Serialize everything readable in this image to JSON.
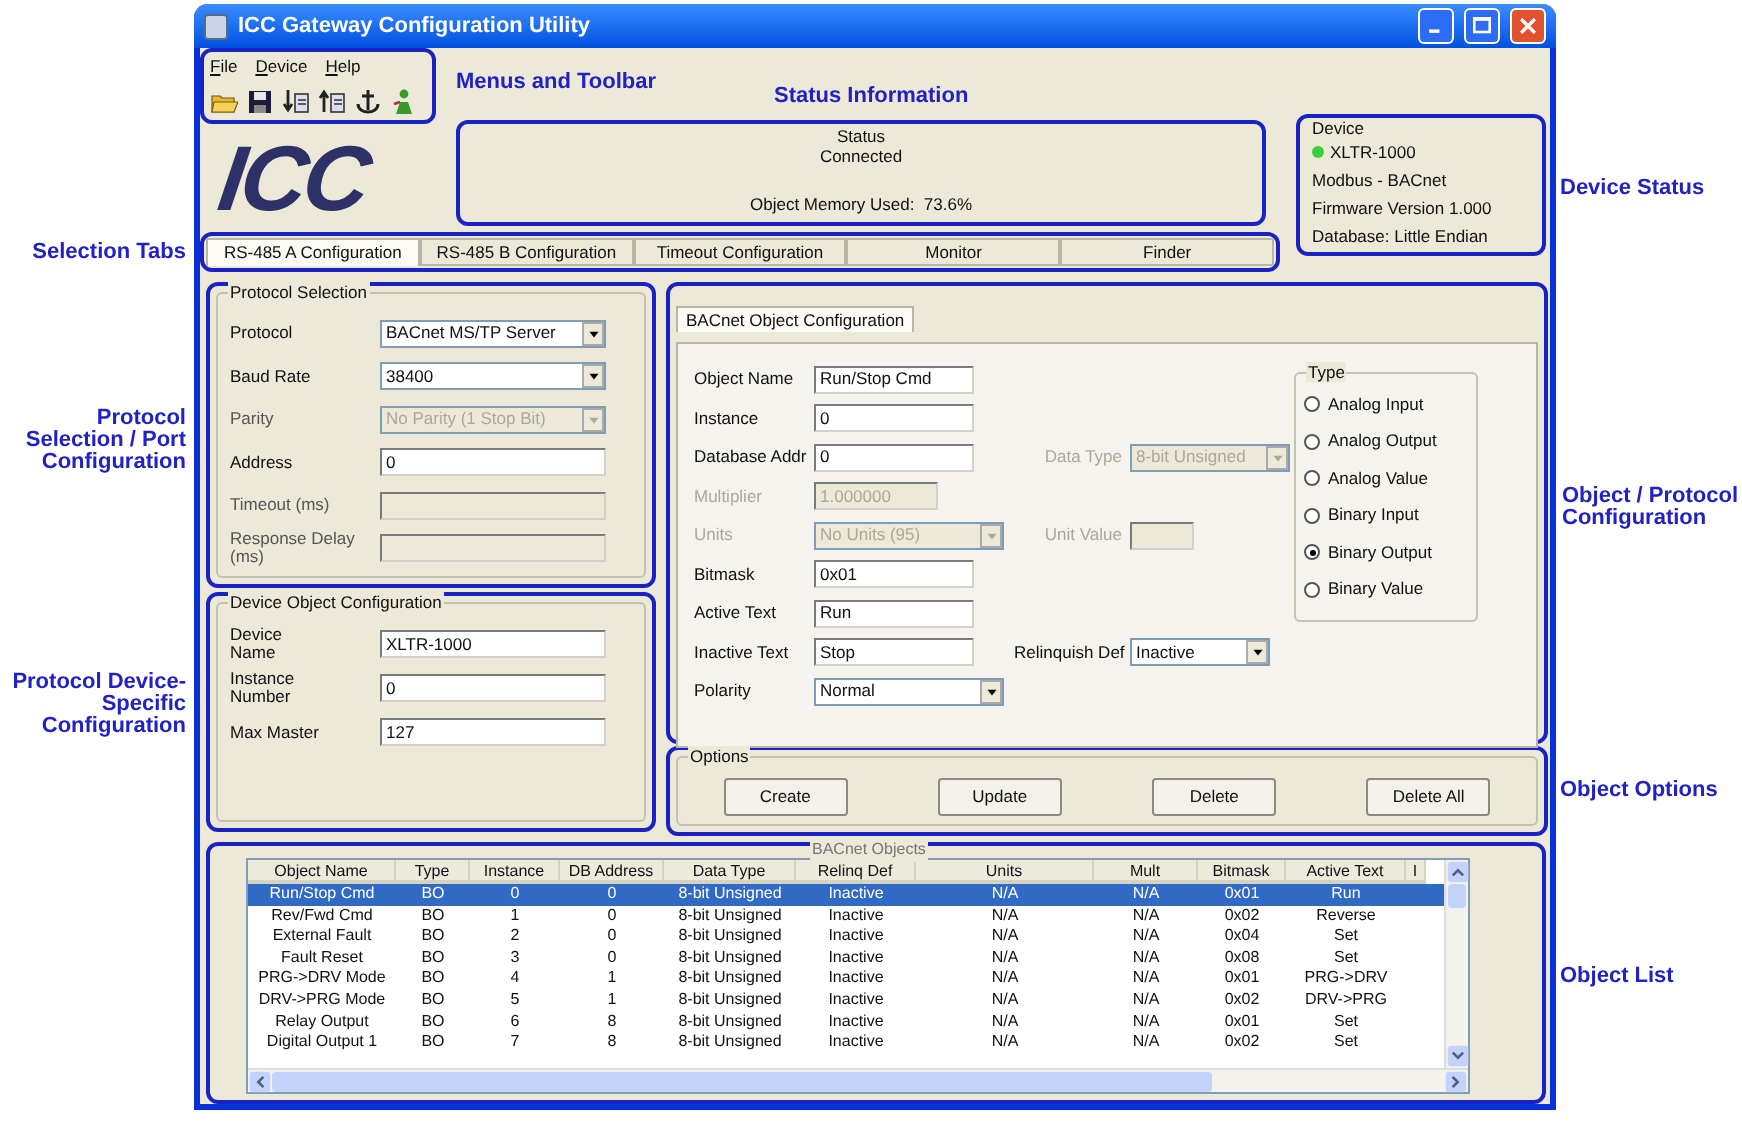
{
  "window": {
    "title": "ICC Gateway Configuration Utility"
  },
  "menus": [
    "File",
    "Device",
    "Help"
  ],
  "logo": "ICC",
  "status": {
    "title": "Status",
    "state": "Connected",
    "memory": "Object Memory Used:  73.6%"
  },
  "device": {
    "title": "Device",
    "name": "XLTR-1000",
    "online": true,
    "lines": [
      "Modbus - BACnet",
      "Firmware Version 1.000",
      "Database: Little Endian"
    ]
  },
  "tabs": [
    {
      "label": "RS-485 A Configuration",
      "selected": true
    },
    {
      "label": "RS-485 B Configuration",
      "selected": false
    },
    {
      "label": "Timeout Configuration",
      "selected": false
    },
    {
      "label": "Monitor",
      "selected": false
    },
    {
      "label": "Finder",
      "selected": false
    }
  ],
  "protocol_selection": {
    "title": "Protocol Selection",
    "fields": [
      {
        "label": "Protocol",
        "kind": "select",
        "value": "BACnet MS/TP Server",
        "disabled": false
      },
      {
        "label": "Baud Rate",
        "kind": "select",
        "value": "38400",
        "disabled": false
      },
      {
        "label": "Parity",
        "kind": "select",
        "value": "No Parity (1 Stop Bit)",
        "disabled": true
      },
      {
        "label": "Address",
        "kind": "text",
        "value": "0",
        "disabled": false
      },
      {
        "label": "Timeout (ms)",
        "kind": "text",
        "disabled": true
      },
      {
        "label": "Response Delay (ms)",
        "kind": "text",
        "disabled": true
      }
    ]
  },
  "device_object_configuration": {
    "title": "Device Object Configuration",
    "fields": [
      {
        "label": "Device Name",
        "kind": "text",
        "value": "XLTR-1000",
        "disabled": false
      },
      {
        "label": "Instance Number",
        "kind": "text",
        "value": "0",
        "disabled": false
      },
      {
        "label": "Max Master",
        "kind": "text",
        "value": "127",
        "disabled": false
      }
    ]
  },
  "object_configuration": {
    "tab": "BACnet Object Configuration",
    "rows": [
      {
        "fields": [
          {
            "label": "Object Name",
            "kind": "text",
            "value": "Run/Stop Cmd",
            "disabled": false
          }
        ]
      },
      {
        "fields": [
          {
            "label": "Instance",
            "kind": "text",
            "value": "0",
            "disabled": false
          }
        ]
      },
      {
        "fields": [
          {
            "label": "Database Addr",
            "kind": "text",
            "value": "0",
            "disabled": false
          },
          {
            "label": "Data Type",
            "kind": "select",
            "value": "8-bit Unsigned",
            "disabled": true
          }
        ]
      },
      {
        "fields": [
          {
            "label": "Multiplier",
            "kind": "text",
            "value": "1.000000",
            "disabled": true
          }
        ]
      },
      {
        "fields": [
          {
            "label": "Units",
            "kind": "select",
            "value": "No Units (95)",
            "disabled": true
          },
          {
            "label": "Unit Value",
            "kind": "text",
            "disabled": true
          }
        ]
      },
      {
        "fields": [
          {
            "label": "Bitmask",
            "kind": "text",
            "value": "0x01",
            "disabled": false
          }
        ]
      },
      {
        "fields": [
          {
            "label": "Active Text",
            "kind": "text",
            "value": "Run",
            "disabled": false
          }
        ]
      },
      {
        "fields": [
          {
            "label": "Inactive Text",
            "kind": "text",
            "value": "Stop",
            "disabled": false
          },
          {
            "label": "Relinquish Def",
            "kind": "select",
            "value": "Inactive",
            "disabled": false
          }
        ]
      },
      {
        "fields": [
          {
            "label": "Polarity",
            "kind": "select",
            "value": "Normal",
            "disabled": false
          }
        ]
      }
    ],
    "type": {
      "title": "Type",
      "options": [
        {
          "label": "Analog Input",
          "selected": false
        },
        {
          "label": "Analog Output",
          "selected": false
        },
        {
          "label": "Analog Value",
          "selected": false
        },
        {
          "label": "Binary Input",
          "selected": false
        },
        {
          "label": "Binary Output",
          "selected": true
        },
        {
          "label": "Binary Value",
          "selected": false
        }
      ]
    }
  },
  "options": {
    "title": "Options",
    "buttons": [
      "Create",
      "Update",
      "Delete",
      "Delete All"
    ]
  },
  "object_list": {
    "title": "BACnet Objects",
    "columns": [
      "Object Name",
      "Type",
      "Instance",
      "DB Address",
      "Data Type",
      "Relinq Def",
      "Units",
      "Mult",
      "Bitmask",
      "Active Text",
      "I"
    ],
    "rows": [
      {
        "selected": true,
        "cells": [
          "Run/Stop Cmd",
          "BO",
          "0",
          "0",
          "8-bit Unsigned",
          "Inactive",
          "N/A",
          "N/A",
          "0x01",
          "Run"
        ]
      },
      {
        "selected": false,
        "cells": [
          "Rev/Fwd Cmd",
          "BO",
          "1",
          "0",
          "8-bit Unsigned",
          "Inactive",
          "N/A",
          "N/A",
          "0x02",
          "Reverse"
        ]
      },
      {
        "selected": false,
        "cells": [
          "External Fault",
          "BO",
          "2",
          "0",
          "8-bit Unsigned",
          "Inactive",
          "N/A",
          "N/A",
          "0x04",
          "Set"
        ]
      },
      {
        "selected": false,
        "cells": [
          "Fault Reset",
          "BO",
          "3",
          "0",
          "8-bit Unsigned",
          "Inactive",
          "N/A",
          "N/A",
          "0x08",
          "Set"
        ]
      },
      {
        "selected": false,
        "cells": [
          "PRG->DRV Mode",
          "BO",
          "4",
          "1",
          "8-bit Unsigned",
          "Inactive",
          "N/A",
          "N/A",
          "0x01",
          "PRG->DRV"
        ]
      },
      {
        "selected": false,
        "cells": [
          "DRV->PRG Mode",
          "BO",
          "5",
          "1",
          "8-bit Unsigned",
          "Inactive",
          "N/A",
          "N/A",
          "0x02",
          "DRV->PRG"
        ]
      },
      {
        "selected": false,
        "cells": [
          "Relay Output",
          "BO",
          "6",
          "8",
          "8-bit Unsigned",
          "Inactive",
          "N/A",
          "N/A",
          "0x01",
          "Set"
        ]
      },
      {
        "selected": false,
        "cells": [
          "Digital Output 1",
          "BO",
          "7",
          "8",
          "8-bit Unsigned",
          "Inactive",
          "N/A",
          "N/A",
          "0x02",
          "Set"
        ]
      }
    ]
  },
  "annotations": [
    "Menus and Toolbar",
    "Status Information",
    "Device Status",
    "Selection Tabs",
    "Protocol Selection / Port Configuration",
    "Protocol Device-Specific Configuration",
    "Object / Protocol Configuration",
    "Object Options",
    "Object List"
  ]
}
